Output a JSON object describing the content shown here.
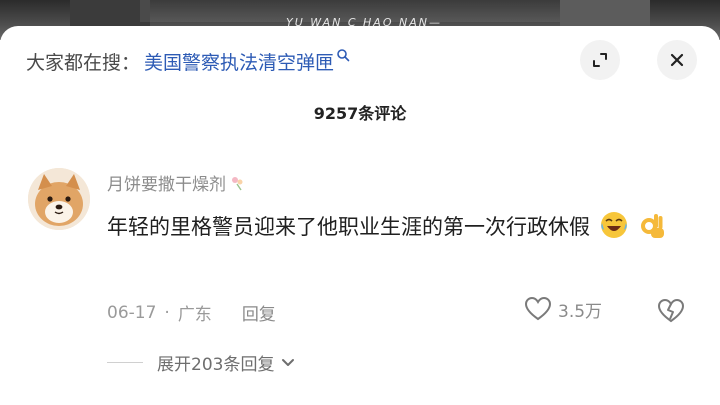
{
  "video": {
    "subtitle_fragment": "YU WAN C  HAO NAN—"
  },
  "search": {
    "label": "大家都在搜：",
    "term": "美国警察执法清空弹匣"
  },
  "comments": {
    "count_label": "9257条评论"
  },
  "comment": {
    "username": "月饼要撒干燥剂",
    "text": "年轻的里格警员迎来了他职业生涯的第一次行政休假",
    "date": "06-17",
    "separator": "·",
    "location": "广东",
    "reply_label": "回复",
    "likes": "3.5万",
    "expand_replies_label": "展开203条回复"
  },
  "icons": {
    "search": "search-icon",
    "expand": "expand-icon",
    "close": "close-icon",
    "like": "heart-icon",
    "dislike": "broken-heart-icon",
    "chevron": "chevron-down-icon"
  },
  "colors": {
    "search_term": "#2d5bb5",
    "text": "#1f1f1f",
    "muted": "#8c8c8c"
  }
}
